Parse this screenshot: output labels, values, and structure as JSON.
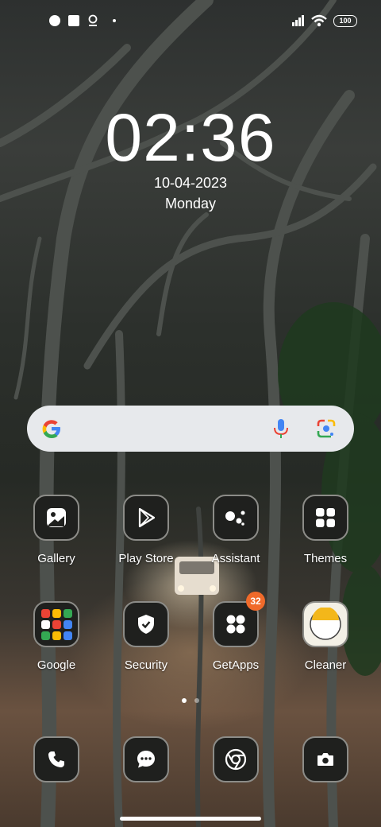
{
  "status_bar": {
    "battery": "100",
    "icons": [
      "face-icon",
      "square-icon",
      "location-icon",
      "dot-icon",
      "signal-icon",
      "wifi-icon",
      "battery-icon"
    ]
  },
  "clock": {
    "time": "02:36",
    "date": "10-04-2023",
    "day": "Monday"
  },
  "search": {
    "icons": [
      "google-logo-icon",
      "microphone-icon",
      "google-lens-icon"
    ]
  },
  "apps_row1": [
    {
      "label": "Gallery",
      "icon": "gallery-icon"
    },
    {
      "label": "Play Store",
      "icon": "play-store-icon"
    },
    {
      "label": "Assistant",
      "icon": "assistant-icon"
    },
    {
      "label": "Themes",
      "icon": "themes-icon"
    }
  ],
  "apps_row2": [
    {
      "label": "Google",
      "icon": "google-folder-icon"
    },
    {
      "label": "Security",
      "icon": "shield-icon"
    },
    {
      "label": "GetApps",
      "icon": "getapps-icon",
      "badge": "32"
    },
    {
      "label": "Cleaner",
      "icon": "cleaner-icon"
    }
  ],
  "dock": [
    {
      "icon": "phone-icon"
    },
    {
      "icon": "messages-icon"
    },
    {
      "icon": "chrome-icon"
    },
    {
      "icon": "camera-icon"
    }
  ],
  "colors": {
    "badge": "#f06a2a",
    "search_bg": "#e7e9ec",
    "icon_bg": "#1f201e"
  }
}
